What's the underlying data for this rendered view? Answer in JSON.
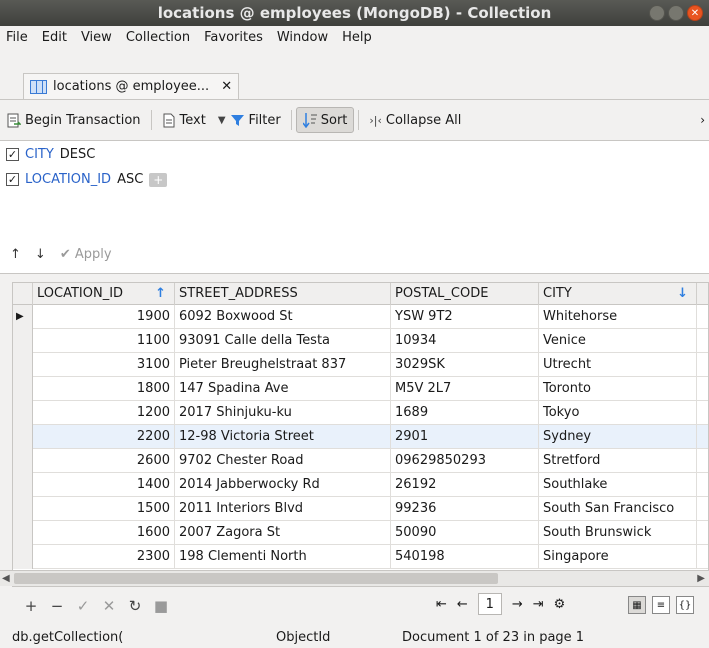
{
  "window": {
    "title": "locations @ employees (MongoDB) - Collection"
  },
  "menu": [
    "File",
    "Edit",
    "View",
    "Collection",
    "Favorites",
    "Window",
    "Help"
  ],
  "tab": {
    "label": "locations @ employee...",
    "close": "✕"
  },
  "toolbar": {
    "begin_transaction": "Begin Transaction",
    "text": "Text",
    "filter": "Filter",
    "sort": "Sort",
    "collapse_all": "Collapse All"
  },
  "sort": {
    "rows": [
      {
        "field": "CITY",
        "direction": "DESC",
        "checked": true
      },
      {
        "field": "LOCATION_ID",
        "direction": "ASC",
        "checked": true
      }
    ],
    "apply_label": "Apply"
  },
  "grid": {
    "columns": [
      "LOCATION_ID",
      "STREET_ADDRESS",
      "POSTAL_CODE",
      "CITY"
    ],
    "rows": [
      [
        "1900",
        "6092 Boxwood St",
        "YSW 9T2",
        "Whitehorse"
      ],
      [
        "1100",
        "93091 Calle della Testa",
        "10934",
        "Venice"
      ],
      [
        "3100",
        "Pieter Breughelstraat 837",
        "3029SK",
        "Utrecht"
      ],
      [
        "1800",
        "147 Spadina Ave",
        "M5V 2L7",
        "Toronto"
      ],
      [
        "1200",
        "2017 Shinjuku-ku",
        "1689",
        "Tokyo"
      ],
      [
        "2200",
        "12-98 Victoria Street",
        "2901",
        "Sydney"
      ],
      [
        "2600",
        "9702 Chester Road",
        "09629850293",
        "Stretford"
      ],
      [
        "1400",
        "2014 Jabberwocky Rd",
        "26192",
        "Southlake"
      ],
      [
        "1500",
        "2011 Interiors Blvd",
        "99236",
        "South San Francisco"
      ],
      [
        "1600",
        "2007 Zagora St",
        "50090",
        "South Brunswick"
      ],
      [
        "2300",
        "198 Clementi North",
        "540198",
        "Singapore"
      ]
    ],
    "highlighted_row": 5
  },
  "pager": {
    "page": "1"
  },
  "status": {
    "query": "db.getCollection(",
    "type": "ObjectId",
    "position": "Document 1 of 23 in page 1"
  }
}
